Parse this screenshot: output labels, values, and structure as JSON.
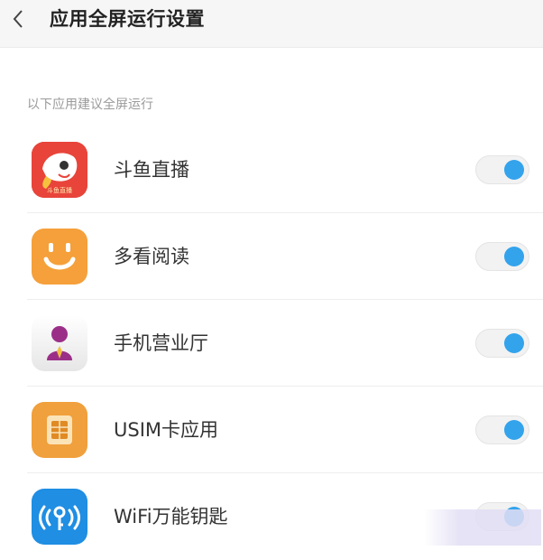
{
  "header": {
    "title": "应用全屏运行设置",
    "back_icon": "chevron-left-icon"
  },
  "section": {
    "label": "以下应用建议全屏运行"
  },
  "apps": [
    {
      "name": "斗鱼直播",
      "icon": "douyu-app-icon",
      "icon_text": "斗鱼直播",
      "icon_color": "#e8443a",
      "enabled": true
    },
    {
      "name": "多看阅读",
      "icon": "duokan-app-icon",
      "icon_color": "#f5a03a",
      "enabled": true
    },
    {
      "name": "手机营业厅",
      "icon": "mobile-hall-app-icon",
      "icon_color": "#9b2f88",
      "enabled": true
    },
    {
      "name": "USIM卡应用",
      "icon": "usim-app-icon",
      "icon_color": "#f0a03c",
      "enabled": true
    },
    {
      "name": "WiFi万能钥匙",
      "icon": "wifi-key-app-icon",
      "icon_color": "#1f8ee3",
      "enabled": true
    }
  ],
  "colors": {
    "toggle_on": "#33a3ec",
    "header_bg": "#f6f6f6"
  }
}
